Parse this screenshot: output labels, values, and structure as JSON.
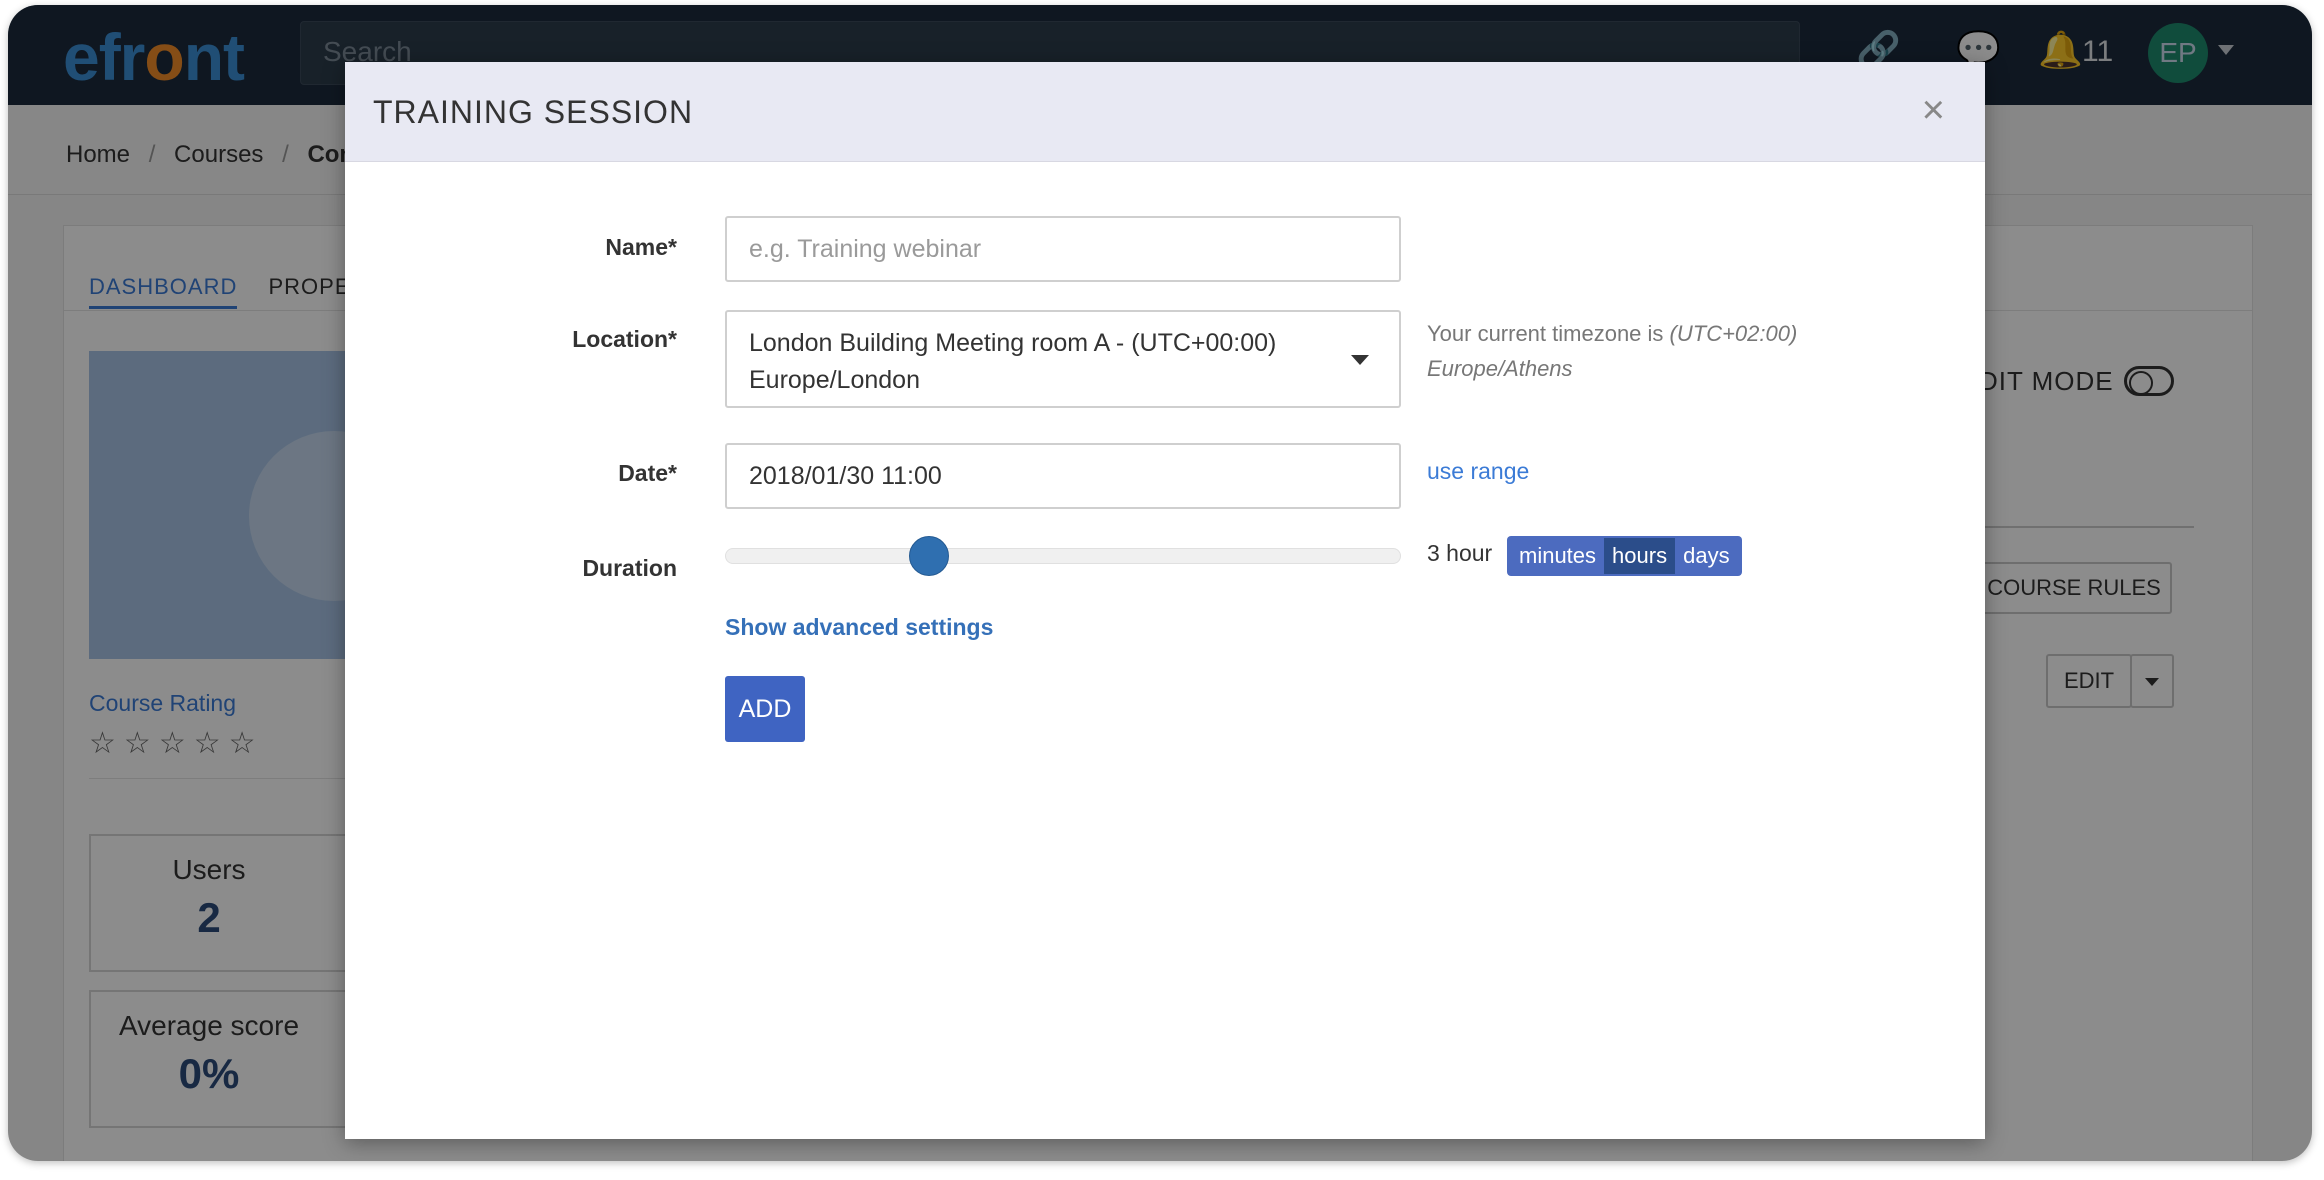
{
  "navbar": {
    "logo": "efront",
    "search_placeholder": "Search",
    "notification_count": "11",
    "avatar_initials": "EP"
  },
  "breadcrumb": {
    "home": "Home",
    "courses": "Courses",
    "current": "Com"
  },
  "course_page": {
    "tabs": [
      "DASHBOARD",
      "PROPE"
    ],
    "course_rating_label": "Course Rating",
    "rating_stars": 0,
    "rating_max": 5,
    "stats": [
      {
        "label": "Users",
        "value": "2"
      },
      {
        "label": "Average score",
        "value": "0%"
      }
    ],
    "edit_mode_label": "DIT MODE",
    "course_rules_button": "COURSE RULES",
    "edit_button": "EDIT"
  },
  "modal": {
    "title": "TRAINING SESSION",
    "close_symbol": "×",
    "name_label": "Name*",
    "name_placeholder": "e.g. Training webinar",
    "location_label": "Location*",
    "location_line1": "London Building Meeting room A - (UTC+00:00)",
    "location_line2": "Europe/London",
    "timezone_prefix": "Your current timezone is",
    "timezone_offset": "(UTC+02:00)",
    "timezone_name": "Europe/Athens",
    "date_label": "Date*",
    "date_value": "2018/01/30 11:00",
    "use_range_link": "use range",
    "duration_label": "Duration",
    "duration_value": "3 hour",
    "duration_slider_fraction": 0.3,
    "duration_units": [
      "minutes",
      "hours",
      "days"
    ],
    "duration_active_unit": "hours",
    "advanced_link": "Show advanced settings",
    "add_button": "ADD"
  }
}
